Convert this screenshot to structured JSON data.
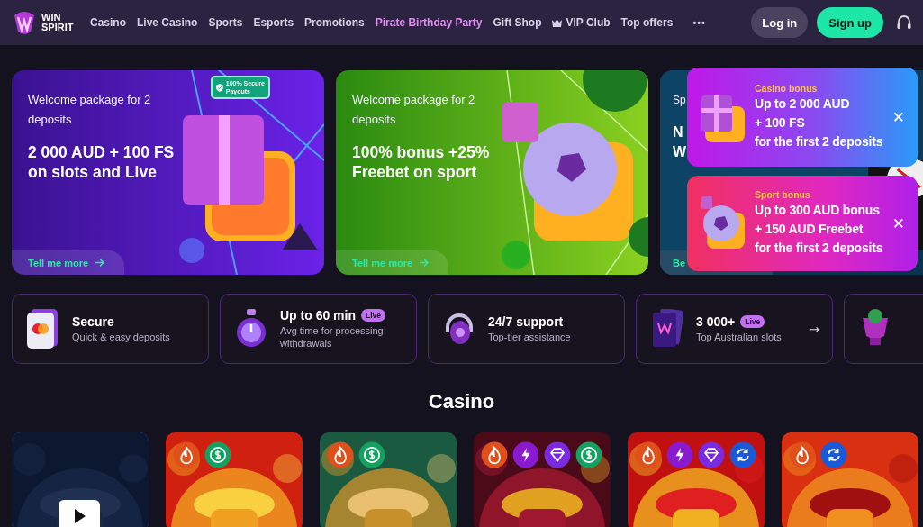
{
  "header": {
    "brand": "WIN SPIRIT",
    "nav": [
      {
        "label": "Casino",
        "highlighted": false,
        "has_icon": false
      },
      {
        "label": "Live Casino",
        "highlighted": false,
        "has_icon": false
      },
      {
        "label": "Sports",
        "highlighted": false,
        "has_icon": false
      },
      {
        "label": "Esports",
        "highlighted": false,
        "has_icon": false
      },
      {
        "label": "Promotions",
        "highlighted": false,
        "has_icon": false
      },
      {
        "label": "Pirate Birthday Party",
        "highlighted": true,
        "has_icon": false
      },
      {
        "label": "Gift Shop",
        "highlighted": false,
        "has_icon": false
      },
      {
        "label": "VIP Club",
        "highlighted": false,
        "has_icon": true
      },
      {
        "label": "Top offers",
        "highlighted": false,
        "has_icon": false
      }
    ],
    "more": "•••",
    "login": "Log in",
    "signup": "Sign up"
  },
  "banners": [
    {
      "kind": "casino",
      "eyebrow": "Welcome package for 2 deposits",
      "headline": "2 000 AUD + 100 FS on slots and Live",
      "badge": "100% Secure Payouts",
      "link": "Tell me more"
    },
    {
      "kind": "sport",
      "eyebrow": "Welcome package for 2 deposits",
      "headline": "100% bonus +25% Freebet on sport",
      "link": "Tell me more"
    },
    {
      "kind": "partial",
      "eyebrow": "Sp",
      "headline_lines": [
        "N",
        "W"
      ],
      "link": "Be"
    }
  ],
  "popups": [
    {
      "kind": "casino",
      "label": "Casino bonus",
      "lines": [
        "Up to 2 000 AUD",
        "+ 100 FS",
        "for the first 2 deposits"
      ],
      "close": "✕"
    },
    {
      "kind": "sport",
      "label": "Sport bonus",
      "lines": [
        "Up to 300 AUD bonus",
        "+ 150 AUD Freebet",
        "for the first 2 deposits"
      ],
      "close": "✕"
    }
  ],
  "features": [
    {
      "kind": "card",
      "title": "Secure",
      "subtitle": "Quick & easy deposits"
    },
    {
      "kind": "timer",
      "title": "Up to 60 min",
      "tag": "Live",
      "subtitle": "Avg time for processing withdrawals"
    },
    {
      "kind": "headset",
      "title": "24/7 support",
      "subtitle": "Top-tier assistance"
    },
    {
      "kind": "slots",
      "title": "3 000+",
      "tag": "Live",
      "subtitle": "Top Australian slots",
      "arrow": "→"
    },
    {
      "kind": "trophy"
    }
  ],
  "section_title": "Casino",
  "games": [
    {
      "kind": "video"
    },
    {
      "kind": "sombrero",
      "badges": [
        {
          "kind": "fire"
        },
        {
          "kind": "dollar"
        }
      ]
    },
    {
      "kind": "jaguar",
      "badges": [
        {
          "kind": "fire"
        },
        {
          "kind": "dollar"
        }
      ]
    },
    {
      "kind": "train",
      "badges": [
        {
          "kind": "fire"
        },
        {
          "kind": "bolt"
        },
        {
          "kind": "diamond"
        },
        {
          "kind": "dollar"
        }
      ]
    },
    {
      "kind": "crown",
      "badges": [
        {
          "kind": "fire"
        },
        {
          "kind": "bolt"
        },
        {
          "kind": "diamond"
        },
        {
          "kind": "refresh"
        }
      ]
    },
    {
      "kind": "fire",
      "badges": [
        {
          "kind": "fire"
        },
        {
          "kind": "refresh"
        }
      ]
    }
  ]
}
